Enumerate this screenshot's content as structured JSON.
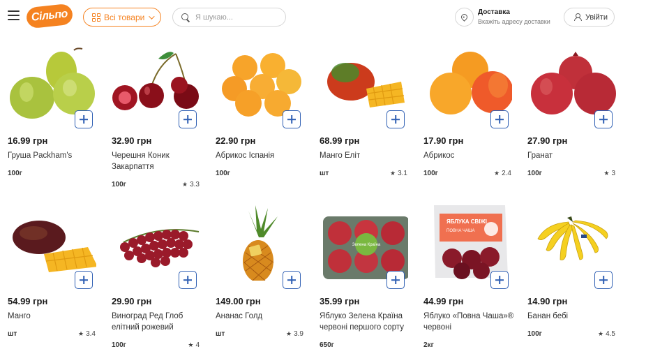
{
  "header": {
    "logo": "Сільпо",
    "all_goods_label": "Всі товари",
    "search_placeholder": "Я шукаю...",
    "delivery_title": "Доставка",
    "delivery_subtitle": "Вкажіть адресу доставки",
    "login_label": "Увійти",
    "accent_color": "#f58220"
  },
  "products": [
    {
      "price": "16.99 грн",
      "name": "Груша Packham's",
      "weight": "100г",
      "rating": ""
    },
    {
      "price": "32.90 грн",
      "name": "Черешня Коник Закарпаття",
      "weight": "100г",
      "rating": "3.3"
    },
    {
      "price": "22.90 грн",
      "name": "Абрикос Іспанія",
      "weight": "100г",
      "rating": ""
    },
    {
      "price": "68.99 грн",
      "name": "Манго Еліт",
      "weight": "шт",
      "rating": "3.1"
    },
    {
      "price": "17.90 грн",
      "name": "Абрикос",
      "weight": "100г",
      "rating": "2.4"
    },
    {
      "price": "27.90 грн",
      "name": "Гранат",
      "weight": "100г",
      "rating": "3"
    },
    {
      "price": "54.99 грн",
      "name": "Манго",
      "weight": "шт",
      "rating": "3.4"
    },
    {
      "price": "29.90 грн",
      "name": "Виноград Ред Глоб елітний рожевий",
      "weight": "100г",
      "rating": "4"
    },
    {
      "price": "149.00 грн",
      "name": "Ананас Голд",
      "weight": "шт",
      "rating": "3.9"
    },
    {
      "price": "35.99 грн",
      "name": "Яблуко Зелена Країна червоні першого сорту",
      "weight": "650г",
      "rating": ""
    },
    {
      "price": "44.99 грн",
      "name": "Яблуко «Повна Чаша»® червоні",
      "weight": "2кг",
      "rating": ""
    },
    {
      "price": "14.90 грн",
      "name": "Банан бебі",
      "weight": "100г",
      "rating": "4.5"
    }
  ],
  "icons": {
    "add": "plus-icon",
    "rating": "star-icon",
    "menu": "hamburger-icon",
    "search": "search-icon",
    "location": "location-pin-icon",
    "user": "user-icon"
  },
  "pack_label": {
    "line1": "ЯБЛУКА СВІЖІ",
    "line2": "ПОВНА ЧАША"
  },
  "tray_label": "Зелена Країна"
}
